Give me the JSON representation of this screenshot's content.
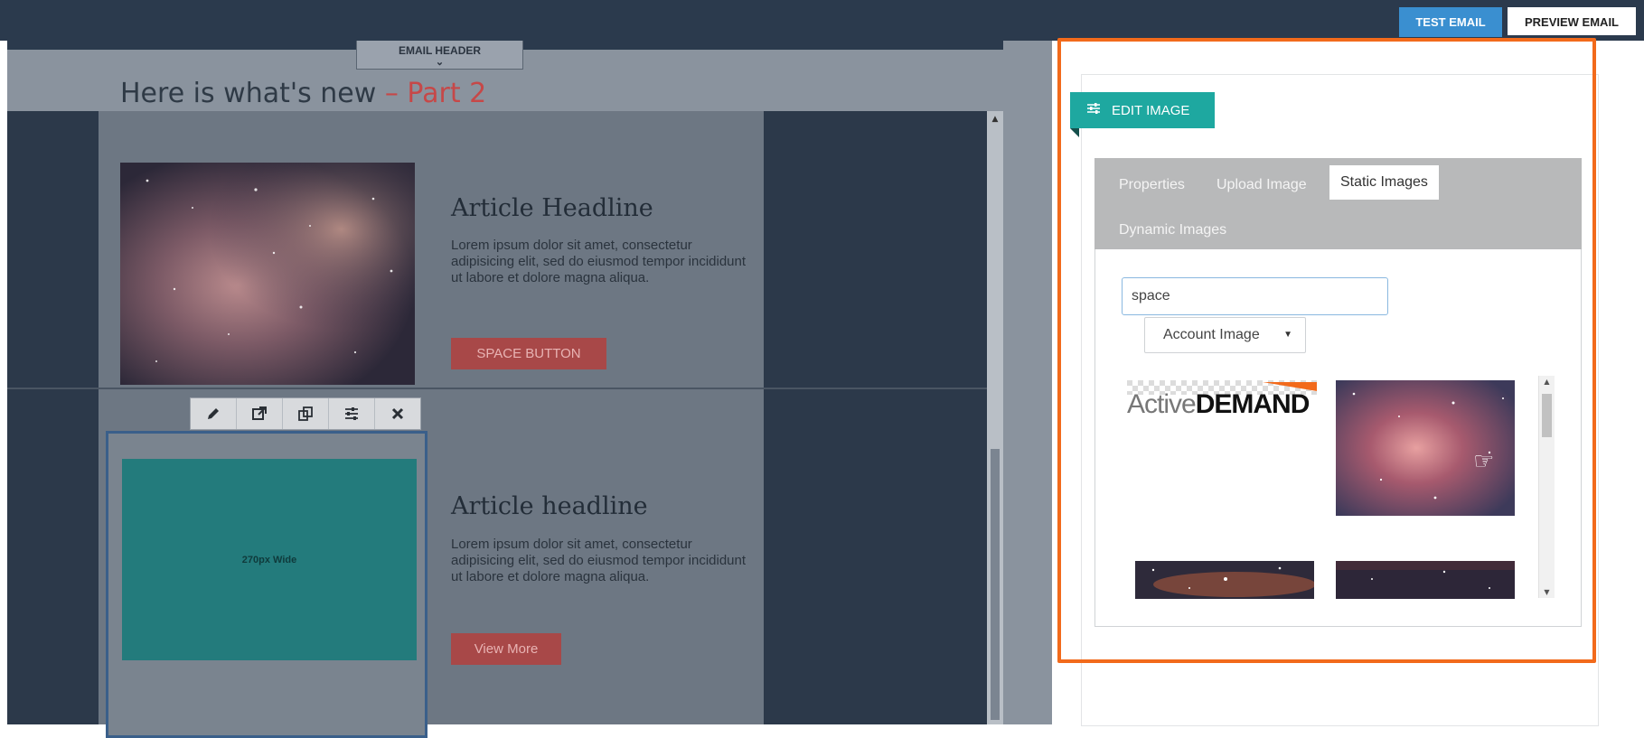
{
  "header": {
    "test_email_label": "TEST EMAIL",
    "preview_email_label": "PREVIEW EMAIL"
  },
  "editor": {
    "email_header_tab_label": "EMAIL HEADER",
    "section_title_main": "Here is what's new",
    "section_title_dash": " – ",
    "section_title_part": "Part 2",
    "article1": {
      "headline": "Article Headline",
      "body": "Lorem ipsum dolor sit amet, consectetur adipisicing elit, sed do eiusmod tempor incididunt ut labore et dolore magna aliqua.",
      "button_label": "SPACE BUTTON"
    },
    "article2": {
      "headline": "Article headline",
      "body": "Lorem ipsum dolor sit amet, consectetur adipisicing elit, sed do eiusmod tempor incididunt ut labore et dolore magna aliqua.",
      "button_label": "View More",
      "placeholder_label": "270px Wide"
    },
    "toolbar_icons": [
      "pencil-icon",
      "external-link-icon",
      "duplicate-icon",
      "sliders-icon",
      "close-icon"
    ]
  },
  "panel": {
    "edit_image_label": "EDIT IMAGE",
    "tabs": [
      "Properties",
      "Upload Image",
      "Static Images",
      "Dynamic Images"
    ],
    "active_tab": "Static Images",
    "search_value": "space",
    "select_value": "Account Image",
    "logo_text_light": "Active",
    "logo_text_bold": "DEMAND"
  },
  "colors": {
    "accent_teal": "#1ea8a0",
    "highlight_orange": "#f26a1b",
    "test_email_blue": "#3a8fd0",
    "editor_dark": "#2b3a4d"
  }
}
